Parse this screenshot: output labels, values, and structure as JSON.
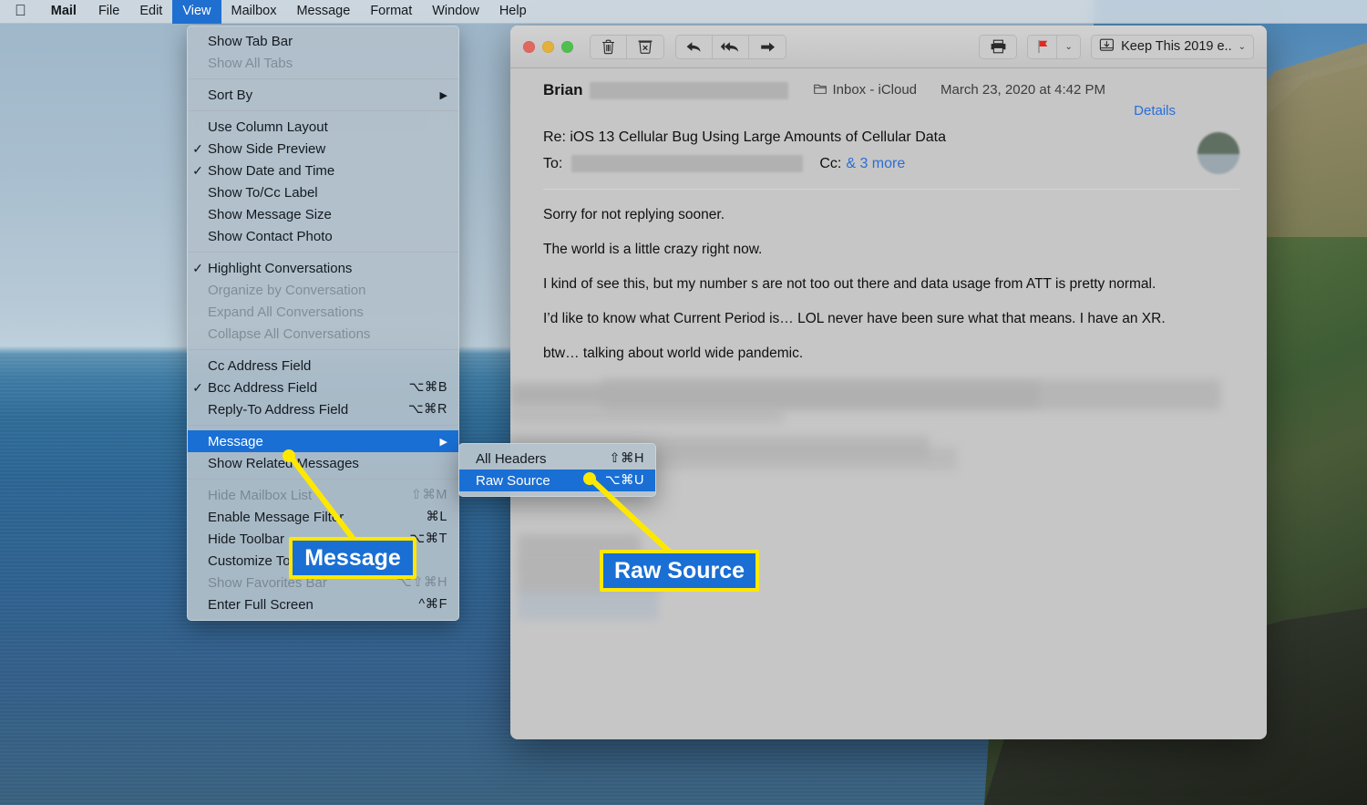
{
  "menubar": {
    "apple_icon": "apple-logo",
    "items": [
      {
        "label": "Mail",
        "bold": true,
        "active": false
      },
      {
        "label": "File",
        "bold": false,
        "active": false
      },
      {
        "label": "Edit",
        "bold": false,
        "active": false
      },
      {
        "label": "View",
        "bold": false,
        "active": true
      },
      {
        "label": "Mailbox",
        "bold": false,
        "active": false
      },
      {
        "label": "Message",
        "bold": false,
        "active": false
      },
      {
        "label": "Format",
        "bold": false,
        "active": false
      },
      {
        "label": "Window",
        "bold": false,
        "active": false
      },
      {
        "label": "Help",
        "bold": false,
        "active": false
      }
    ]
  },
  "view_menu": {
    "items": [
      {
        "label": "Show Tab Bar",
        "check": "",
        "key": "",
        "disabled": false,
        "arrow": false,
        "selected": false
      },
      {
        "label": "Show All Tabs",
        "check": "",
        "key": "",
        "disabled": true,
        "arrow": false,
        "selected": false
      },
      {
        "sep": true
      },
      {
        "label": "Sort By",
        "check": "",
        "key": "",
        "disabled": false,
        "arrow": true,
        "selected": false
      },
      {
        "sep": true
      },
      {
        "label": "Use Column Layout",
        "check": "",
        "key": "",
        "disabled": false,
        "arrow": false,
        "selected": false
      },
      {
        "label": "Show Side Preview",
        "check": "✓",
        "key": "",
        "disabled": false,
        "arrow": false,
        "selected": false
      },
      {
        "label": "Show Date and Time",
        "check": "✓",
        "key": "",
        "disabled": false,
        "arrow": false,
        "selected": false
      },
      {
        "label": "Show To/Cc Label",
        "check": "",
        "key": "",
        "disabled": false,
        "arrow": false,
        "selected": false
      },
      {
        "label": "Show Message Size",
        "check": "",
        "key": "",
        "disabled": false,
        "arrow": false,
        "selected": false
      },
      {
        "label": "Show Contact Photo",
        "check": "",
        "key": "",
        "disabled": false,
        "arrow": false,
        "selected": false
      },
      {
        "sep": true
      },
      {
        "label": "Highlight Conversations",
        "check": "✓",
        "key": "",
        "disabled": false,
        "arrow": false,
        "selected": false
      },
      {
        "label": "Organize by Conversation",
        "check": "",
        "key": "",
        "disabled": true,
        "arrow": false,
        "selected": false
      },
      {
        "label": "Expand All Conversations",
        "check": "",
        "key": "",
        "disabled": true,
        "arrow": false,
        "selected": false
      },
      {
        "label": "Collapse All Conversations",
        "check": "",
        "key": "",
        "disabled": true,
        "arrow": false,
        "selected": false
      },
      {
        "sep": true
      },
      {
        "label": "Cc Address Field",
        "check": "",
        "key": "",
        "disabled": false,
        "arrow": false,
        "selected": false
      },
      {
        "label": "Bcc Address Field",
        "check": "✓",
        "key": "⌥⌘B",
        "disabled": false,
        "arrow": false,
        "selected": false
      },
      {
        "label": "Reply-To Address Field",
        "check": "",
        "key": "⌥⌘R",
        "disabled": false,
        "arrow": false,
        "selected": false
      },
      {
        "sep": true
      },
      {
        "label": "Message",
        "check": "",
        "key": "",
        "disabled": false,
        "arrow": true,
        "selected": true
      },
      {
        "label": "Show Related Messages",
        "check": "",
        "key": "",
        "disabled": false,
        "arrow": false,
        "selected": false
      },
      {
        "sep": true
      },
      {
        "label": "Hide Mailbox List",
        "check": "",
        "key": "⇧⌘M",
        "disabled": true,
        "arrow": false,
        "selected": false
      },
      {
        "label": "Enable Message Filter",
        "check": "",
        "key": "⌘L",
        "disabled": false,
        "arrow": false,
        "selected": false
      },
      {
        "label": "Hide Toolbar",
        "check": "",
        "key": "⌥⌘T",
        "disabled": false,
        "arrow": false,
        "selected": false
      },
      {
        "label": "Customize Toolbar…",
        "check": "",
        "key": "",
        "disabled": false,
        "arrow": false,
        "selected": false
      },
      {
        "label": "Show Favorites Bar",
        "check": "",
        "key": "⌥⇧⌘H",
        "disabled": true,
        "arrow": false,
        "selected": false
      },
      {
        "label": "Enter Full Screen",
        "check": "",
        "key": "^⌘F",
        "disabled": false,
        "arrow": false,
        "selected": false
      }
    ]
  },
  "submenu": {
    "items": [
      {
        "label": "All Headers",
        "key": "⇧⌘H",
        "selected": false
      },
      {
        "label": "Raw Source",
        "key": "⌥⌘U",
        "selected": true
      }
    ]
  },
  "mail_window": {
    "toolbar": {
      "delete_icon": "trash-icon",
      "junk_icon": "junk-mail-icon",
      "reply_icon": "reply-arrow-icon",
      "reply_all_icon": "reply-all-arrow-icon",
      "forward_icon": "forward-arrow-icon",
      "print_icon": "printer-icon",
      "flag_icon": "red-flag-icon",
      "flag_caret": "⌄",
      "move_icon": "move-to-folder-icon",
      "move_label": "Keep This 2019 e..",
      "move_caret": "⌄"
    },
    "header": {
      "sender": "Brian",
      "mailbox_icon": "folder-icon",
      "mailbox": "Inbox - iCloud",
      "date": "March 23, 2020 at 4:42 PM",
      "details_link": "Details",
      "subject": "Re: iOS 13 Cellular Bug Using Large Amounts of Cellular Data",
      "to_label": "To:",
      "cc_label": "Cc:",
      "cc_more": "& 3 more"
    },
    "body_paragraphs": [
      "Sorry for not replying sooner.",
      "The world is a little crazy right now.",
      "I kind of see this, but my number s are not too out there and data usage from ATT is pretty normal.",
      "I’d like to know what Current Period is…  LOL  never have been sure what that means.  I have an XR.",
      "btw…  talking about world wide pandemic."
    ]
  },
  "annotations": {
    "callout_message": "Message",
    "callout_raw_source": "Raw Source",
    "highlight_color": "#ffe800",
    "selection_color": "#1a6fd4"
  }
}
